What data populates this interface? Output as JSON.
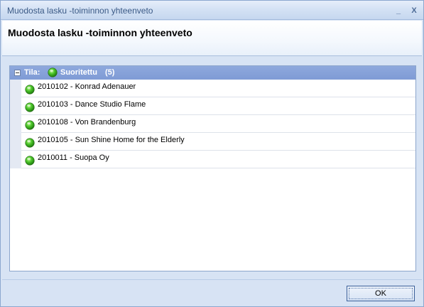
{
  "window": {
    "title": "Muodosta lasku -toiminnon yhteenveto",
    "minimize_symbol": "_",
    "close_symbol": "X"
  },
  "header": {
    "heading": "Muodosta lasku -toiminnon yhteenveto"
  },
  "group": {
    "label": "Tila:",
    "status_text": "Suoritettu",
    "count": "(5)",
    "status_icon": "green-ball-icon",
    "expanded": true
  },
  "items": [
    {
      "text": "2010102 - Konrad Adenauer",
      "icon": "green-ball-icon"
    },
    {
      "text": "2010103 - Dance Studio Flame",
      "icon": "green-ball-icon"
    },
    {
      "text": "2010108 - Von Brandenburg",
      "icon": "green-ball-icon"
    },
    {
      "text": "2010105 - Sun Shine Home for the Elderly",
      "icon": "green-ball-icon"
    },
    {
      "text": "2010011 - Suopa Oy",
      "icon": "green-ball-icon"
    }
  ],
  "footer": {
    "ok_label": "OK"
  },
  "colors": {
    "group_header": "#8ea8dd",
    "status_ok": "#3cb81f",
    "window_bg": "#d7e3f4"
  }
}
